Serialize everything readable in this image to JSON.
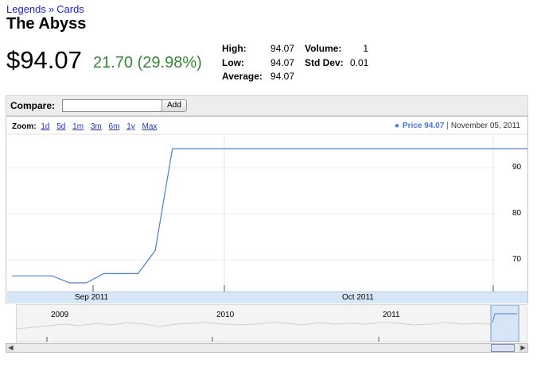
{
  "breadcrumb": {
    "items": [
      "Legends",
      "Cards"
    ],
    "separator": "»"
  },
  "title": "The Abyss",
  "quote": {
    "price": "$94.07",
    "change": "21.70 (29.98%)"
  },
  "stats": {
    "high_label": "High:",
    "high": "94.07",
    "low_label": "Low:",
    "low": "94.07",
    "average_label": "Average:",
    "average": "94.07",
    "volume_label": "Volume:",
    "volume": "1",
    "stddev_label": "Std Dev:",
    "stddev": "0.01"
  },
  "compare": {
    "label": "Compare:",
    "value": "",
    "button": "Add"
  },
  "zoom": {
    "label": "Zoom:",
    "options": [
      "1d",
      "5d",
      "1m",
      "3m",
      "6m",
      "1y",
      "Max"
    ]
  },
  "legend": {
    "dot": "●",
    "series": "Price",
    "value": "94.07",
    "sep": "|",
    "date": "November 05, 2011"
  },
  "chart_data": {
    "type": "line",
    "series": [
      {
        "name": "Price",
        "x": [
          "2011-08-07",
          "2011-08-14",
          "2011-08-17",
          "2011-08-20",
          "2011-08-23",
          "2011-08-29",
          "2011-09-01",
          "2011-09-04",
          "2011-09-15",
          "2011-10-01",
          "2011-10-15",
          "2011-11-01",
          "2011-11-05"
        ],
        "values": [
          66.5,
          66.5,
          65,
          65,
          67,
          67,
          72,
          94.07,
          94.07,
          94.07,
          94.07,
          94.07,
          94.07
        ]
      }
    ],
    "y_ticks": [
      "90",
      "80",
      "70"
    ],
    "x_tick_labels": [
      "Sep 2011",
      "Oct 2011"
    ],
    "navigator_labels": [
      "2009",
      "2010",
      "2011"
    ],
    "grid": true,
    "legend_position": "top-right"
  },
  "colors": {
    "line": "#4a7fd4",
    "positive": "#338833",
    "link": "#2233bb",
    "axis_band": "#d6e6f7"
  }
}
